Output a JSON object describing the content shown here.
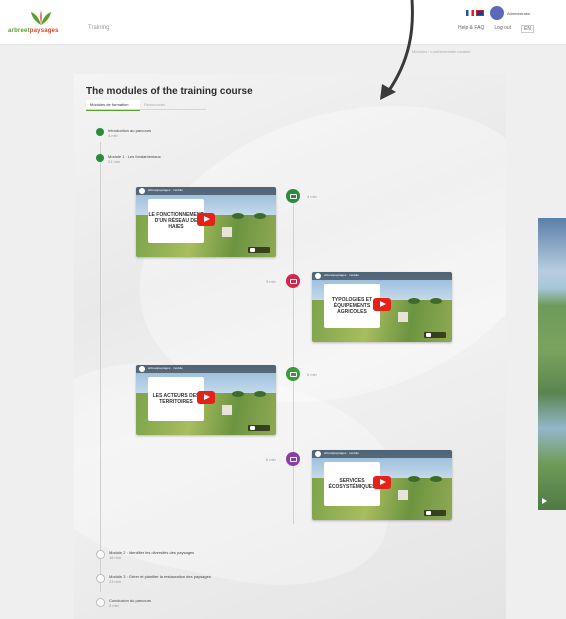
{
  "header": {
    "logo_text_a": "arbreet",
    "logo_text_b": "paysages",
    "nav_label": "Training",
    "username": "Administrator",
    "links": [
      "Help & FAQ",
      "Log out",
      "EN"
    ],
    "breadcrumb": "Modules / Lumbermaster module"
  },
  "page": {
    "title": "The modules of the training course",
    "tabs": [
      "Modules de formation",
      "Ressources"
    ]
  },
  "items": [
    {
      "title": "Introduction au parcours",
      "sub": "4 min"
    },
    {
      "title": "Module 1 : Les fondamentaux",
      "sub": "21 min"
    },
    {
      "title": "Module 2 : Identifier les diversités des paysages",
      "sub": "18 min"
    },
    {
      "title": "Module 3 : Gérer et planifier la restauration des paysages",
      "sub": "23 min"
    },
    {
      "title": "Conclusion du parcours",
      "sub": "3 min"
    }
  ],
  "videos": [
    {
      "caption": "LE FONCTIONNEMENT D'UN RÉSEAU DE HAIES",
      "node_label": "4 min",
      "color": "#2a8a3e"
    },
    {
      "caption": "TYPOLOGIES ET ÉQUIPEMENTS AGRICOLES",
      "node_label": "5 min",
      "color": "#d4264b"
    },
    {
      "caption": "LES ACTEURS DES TERRITOIRES",
      "node_label": "6 min",
      "color": "#3a9a3a"
    },
    {
      "caption": "SERVICES ÉCOSYSTÉMIQUES",
      "node_label": "6 min",
      "color": "#8a3fa3"
    }
  ],
  "video_top_text": "arbreetpaysages · module",
  "colors": {
    "brand_green": "#5aa02c",
    "brand_red": "#d8452b",
    "youtube_red": "#e62117"
  }
}
